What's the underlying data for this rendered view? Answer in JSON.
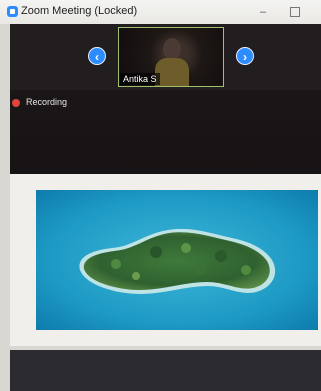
{
  "window": {
    "title": "Zoom Meeting (Locked)",
    "minimize_glyph": "–",
    "icons": [
      "zoom-app-icon",
      "minimize-icon",
      "maximize-icon"
    ]
  },
  "gallery": {
    "participant_name": "Antika S",
    "prev_glyph": "‹",
    "next_glyph": "›"
  },
  "status": {
    "recording_label": "Recording",
    "recording_color": "#e0443b"
  },
  "colors": {
    "zoom_blue": "#2d8cff",
    "active_speaker_border": "#9ec26b"
  },
  "shared_content": {
    "image": "aerial-island-photo"
  }
}
